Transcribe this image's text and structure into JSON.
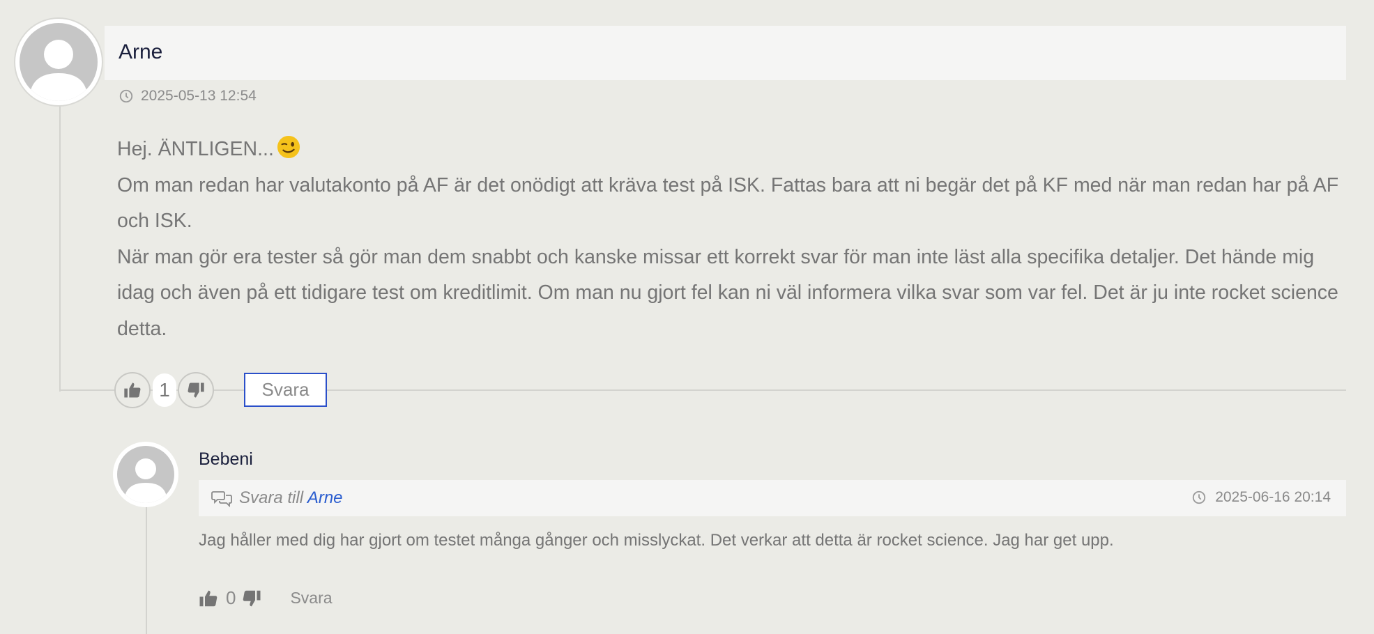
{
  "comment": {
    "author": "Arne",
    "timestamp": "2025-05-13 12:54",
    "body": [
      "Hej. ÄNTLIGEN...",
      "Om man redan har valutakonto på AF är det onödigt att kräva test på ISK. Fattas bara att ni begär det på KF med när man redan har på AF och ISK.",
      "När man gör era tester så gör man dem snabbt och kanske missar ett korrekt svar för man inte läst alla specifika detaljer. Det hände mig idag och även på ett tidigare test om kreditlimit. Om man nu gjort fel kan ni väl informera vilka svar som var fel. Det är ju inte rocket science detta."
    ],
    "emoji": "winking-face-icon",
    "votes": "1",
    "reply_label": "Svara"
  },
  "reply": {
    "author": "Bebeni",
    "reply_to_prefix": "Svara till",
    "reply_to_name": "Arne",
    "timestamp": "2025-06-16 20:14",
    "body": "Jag håller med dig har gjort om testet många gånger och misslyckat. Det verkar att detta är rocket science. Jag har get upp.",
    "votes": "0",
    "reply_label": "Svara"
  },
  "colors": {
    "background": "#ebebe6",
    "name_bar": "#f5f5f4",
    "author_text": "#1a1f3c",
    "link": "#2a5dcf",
    "button_border": "#2a4fc9"
  }
}
